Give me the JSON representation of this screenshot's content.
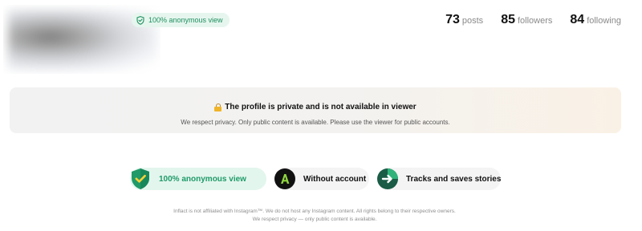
{
  "profile": {
    "avatar_state": "blurred",
    "badge": {
      "icon": "shield-check-icon",
      "label": "100% anonymous view",
      "color": "#1f8f5f",
      "background": "#e6f6ef"
    }
  },
  "stats": [
    {
      "value": "73",
      "label": "posts"
    },
    {
      "value": "85",
      "label": "followers"
    },
    {
      "value": "84",
      "label": "following"
    }
  ],
  "notice": {
    "icon": "lock-icon",
    "title": "The profile is private and is not available in viewer",
    "subtitle": "We respect privacy. Only public content is available. Please use the viewer for public accounts."
  },
  "features": [
    {
      "icon": "shield-check-icon",
      "label": "100% anonymous view",
      "accent": "#1f9a68"
    },
    {
      "icon": "account-logo-icon",
      "label": "Without account",
      "accent": "#8fd63f"
    },
    {
      "icon": "arrow-right-icon",
      "label": "Tracks and saves stories",
      "accent": "#2fb37a"
    }
  ],
  "footer": {
    "line1": "Inflact is not affiliated with Instagram™. We do not host any Instagram content. All rights belong to their respective owners.",
    "line2": "We respect privacy — only public content is available."
  }
}
